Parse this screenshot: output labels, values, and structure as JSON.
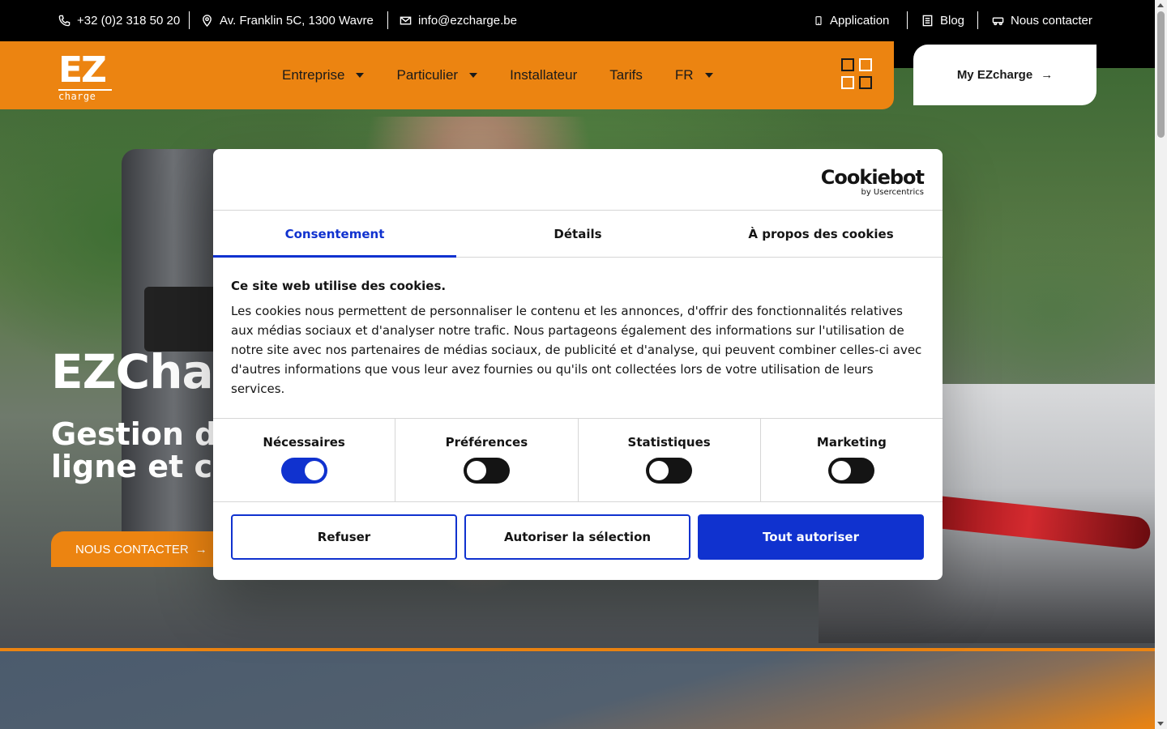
{
  "topbar": {
    "phone": "+32 (0)2 318 50 20",
    "address": "Av. Franklin 5C, 1300 Wavre",
    "email": "info@ezcharge.be",
    "application": "Application",
    "blog": "Blog",
    "contact": "Nous contacter"
  },
  "header": {
    "logo_main": "EZ",
    "logo_sub": "charge",
    "nav": [
      "Entreprise",
      "Particulier",
      "Installateur",
      "Tarifs",
      "FR"
    ],
    "my_ez": "My EZcharge"
  },
  "hero": {
    "title": "EZCharge",
    "subtitle": "Gestion de la recharge en ligne et ca publique",
    "button": "NOUS CONTACTER"
  },
  "cookie": {
    "brand": "Cookiebot",
    "brand_sub": "by Usercentrics",
    "tabs": [
      "Consentement",
      "Détails",
      "À propos des cookies"
    ],
    "title": "Ce site web utilise des cookies.",
    "text": "Les cookies nous permettent de personnaliser le contenu et les annonces, d'offrir des fonctionnalités relatives aux médias sociaux et d'analyser notre trafic. Nous partageons également des informations sur l'utilisation de notre site avec nos partenaires de médias sociaux, de publicité et d'analyse, qui peuvent combiner celles-ci avec d'autres informations que vous leur avez fournies ou qu'ils ont collectées lors de votre utilisation de leurs services.",
    "categories": [
      {
        "label": "Nécessaires",
        "checked": true
      },
      {
        "label": "Préférences",
        "checked": false
      },
      {
        "label": "Statistiques",
        "checked": false
      },
      {
        "label": "Marketing",
        "checked": false
      }
    ],
    "btn_refuse": "Refuser",
    "btn_selection": "Autoriser la sélection",
    "btn_all": "Tout autoriser"
  },
  "colors": {
    "brand_orange": "#ec8411",
    "cookie_blue": "#1032cf"
  }
}
